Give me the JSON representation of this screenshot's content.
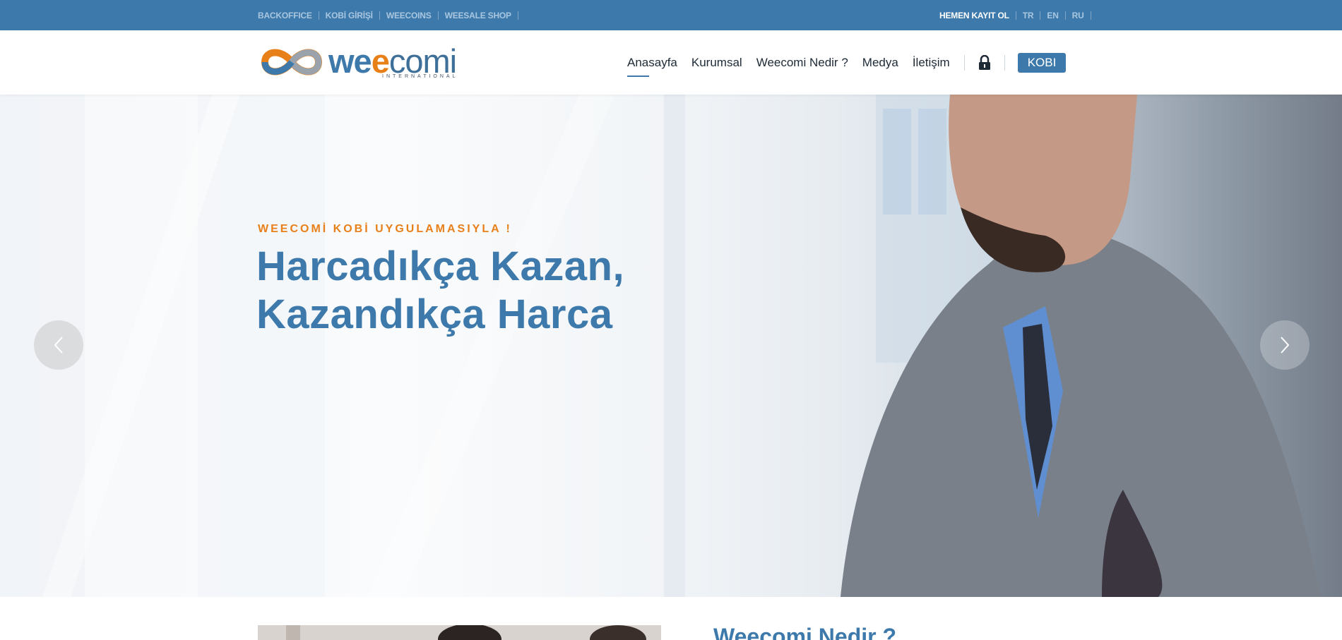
{
  "topbar": {
    "left_links": [
      "BACKOFFICE",
      "KOBİ GİRİŞİ",
      "WEECOINS",
      "WEESALE SHOP"
    ],
    "register": "HEMEN KAYIT OL",
    "languages": [
      "TR",
      "EN",
      "RU"
    ]
  },
  "logo": {
    "word_a": "we",
    "word_b": "e",
    "word_c": "comi",
    "sub": "INTERNATIONAL"
  },
  "nav": {
    "items": [
      "Anasayfa",
      "Kurumsal",
      "Weecomi Nedir ?",
      "Medya",
      "İletişim"
    ],
    "active": "Anasayfa",
    "lock_icon": "lock-icon",
    "kobi_button": "KOBI"
  },
  "hero": {
    "eyebrow": "WEECOMİ KOBİ UYGULAMASIYLA !",
    "headline_line1": "Harcadıkça Kazan,",
    "headline_line2": "Kazandıkça Harca",
    "prev_icon": "chevron-left-icon",
    "next_icon": "chevron-right-icon"
  },
  "section": {
    "title": "Weecomi Nedir ?"
  },
  "colors": {
    "brand_blue": "#3d7aab",
    "brand_orange": "#e8801a"
  }
}
